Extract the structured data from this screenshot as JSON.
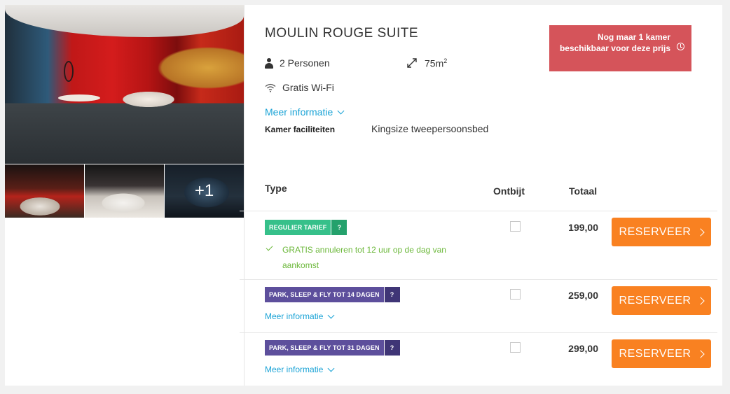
{
  "room": {
    "title": "MOULIN ROUGE SUITE",
    "alert": "Nog maar 1 kamer beschikbaar voor deze prijs",
    "persons": "2 Personen",
    "size": "75m",
    "size_sup": "2",
    "wifi": "Gratis Wi-Fi",
    "more_info": "Meer informatie",
    "facilities_label": "Kamer faciliteiten",
    "facilities_value": "Kingsize tweepersoonsbed"
  },
  "gallery": {
    "extra_count": "+1"
  },
  "table": {
    "col_type": "Type",
    "col_breakfast": "Ontbijt",
    "col_total": "Totaal"
  },
  "rates": [
    {
      "tag": "REGULIER TARIEF",
      "tag_q": "?",
      "cancel": "GRATIS annuleren tot 12 uur op de dag van aankomst",
      "price": "199,00",
      "button": "RESERVEER"
    },
    {
      "tag": "PARK, SLEEP & FLY TOT 14 DAGEN",
      "tag_q": "?",
      "more_info": "Meer informatie",
      "price": "259,00",
      "button": "RESERVEER"
    },
    {
      "tag": "PARK, SLEEP & FLY TOT 31 DAGEN",
      "tag_q": "?",
      "more_info": "Meer informatie",
      "price": "299,00",
      "button": "RESERVEER"
    }
  ],
  "colors": {
    "accent_orange": "#f98121",
    "alert_red": "#d5545a",
    "link_blue": "#1aa3d6",
    "tag_green": "#36c08a",
    "tag_purple": "#5d4f9c",
    "cancel_green": "#6cb83b"
  }
}
